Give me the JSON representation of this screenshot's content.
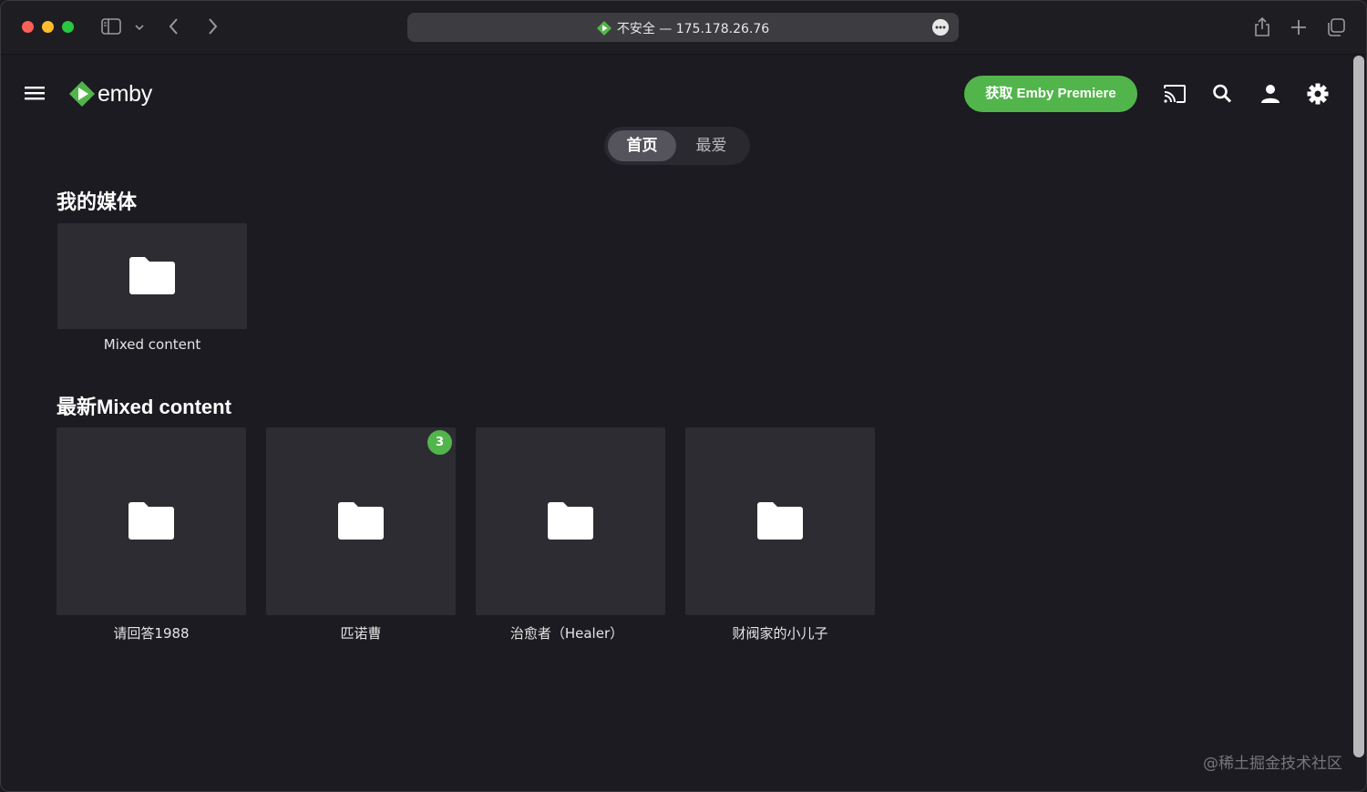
{
  "browser": {
    "url_text": "不安全 — 175.178.26.76"
  },
  "app": {
    "logo_text": "emby",
    "premiere_label": "获取 Emby Premiere",
    "tabs": [
      {
        "label": "首页",
        "active": true
      },
      {
        "label": "最爱",
        "active": false
      }
    ]
  },
  "my_media": {
    "title": "我的媒体",
    "items": [
      {
        "label": "Mixed content"
      }
    ]
  },
  "latest": {
    "title": "最新Mixed content",
    "items": [
      {
        "label": "请回答1988",
        "badge": ""
      },
      {
        "label": "匹诺曹",
        "badge": "3"
      },
      {
        "label": "治愈者（Healer）",
        "badge": ""
      },
      {
        "label": "财阀家的小儿子",
        "badge": ""
      }
    ]
  },
  "watermark": "@稀土掘金技术社区",
  "colors": {
    "accent": "#52b54b",
    "background": "#1c1b21",
    "card": "#2d2c32"
  },
  "icons": [
    "sidebar-toggle-icon",
    "chevron-left-icon",
    "chevron-right-icon",
    "share-icon",
    "plus-icon",
    "tabs-overview-icon",
    "menu-icon",
    "cast-icon",
    "search-icon",
    "user-icon",
    "gear-icon",
    "folder-icon"
  ]
}
